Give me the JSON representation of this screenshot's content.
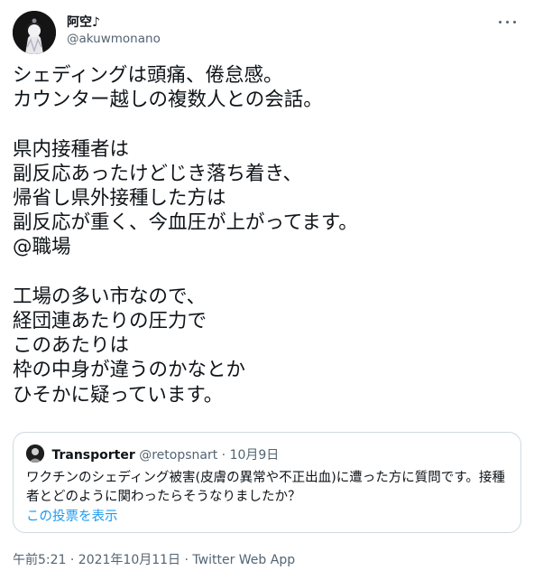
{
  "author": {
    "display_name": "阿空♪",
    "handle": "@akuwmonano"
  },
  "tweet": {
    "text": "シェディングは頭痛、倦怠感。\nカウンター越しの複数人との会話。\n\n県内接種者は\n副反応あったけどじき落ち着き、\n帰省し県外接種した方は\n副反応が重く、今血圧が上がってます。\n@職場\n\n工場の多い市なので、\n経団連あたりの圧力で\nこのあたりは\n枠の中身が違うのかなとか\nひそかに疑っています。"
  },
  "quote": {
    "display_name": "Transporter",
    "handle": "@retopsnart",
    "separator": "·",
    "date": "10月9日",
    "text": "ワクチンのシェディング被害(皮膚の異常や不正出血)に遭った方に質問です。接種者とどのように関わったらそうなりましたか？",
    "link_label": "この投票を表示"
  },
  "meta": {
    "timestamp": "午前5:21 · 2021年10月11日 · Twitter Web App"
  },
  "icons": {
    "more": "more-horizontal-icon",
    "avatar": "user-avatar",
    "quote_avatar": "quoted-user-avatar"
  },
  "colors": {
    "text": "#0f1419",
    "secondary": "#536471",
    "link": "#1d9bf0",
    "border": "#cfd9de"
  }
}
